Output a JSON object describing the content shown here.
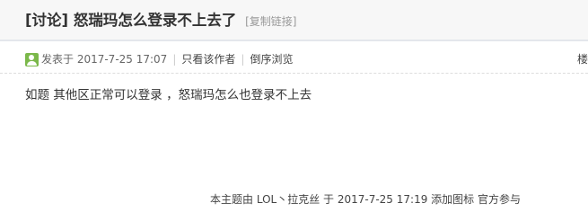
{
  "thread": {
    "title_tag": "[讨论]",
    "title": "怒瑞玛怎么登录不上去了",
    "copy_link": "[复制链接]"
  },
  "meta": {
    "posted_at": "发表于 2017-7-25 17:07",
    "only_author": "只看该作者",
    "reverse_order": "倒序浏览",
    "floor": "楼"
  },
  "post": {
    "content": "如题 其他区正常可以登录 ，怒瑞玛怎么也登录不上去"
  },
  "footer": {
    "note_prefix": "本主题由 LOL丶拉克丝 于 2017-7-25 17:19",
    "add_icon": "添加图标",
    "official": "官方参与"
  },
  "icons": {
    "online_status": "user-online-icon"
  },
  "colors": {
    "online_green": "#7bb84a",
    "title_text": "#333333",
    "muted_link": "#999999"
  }
}
